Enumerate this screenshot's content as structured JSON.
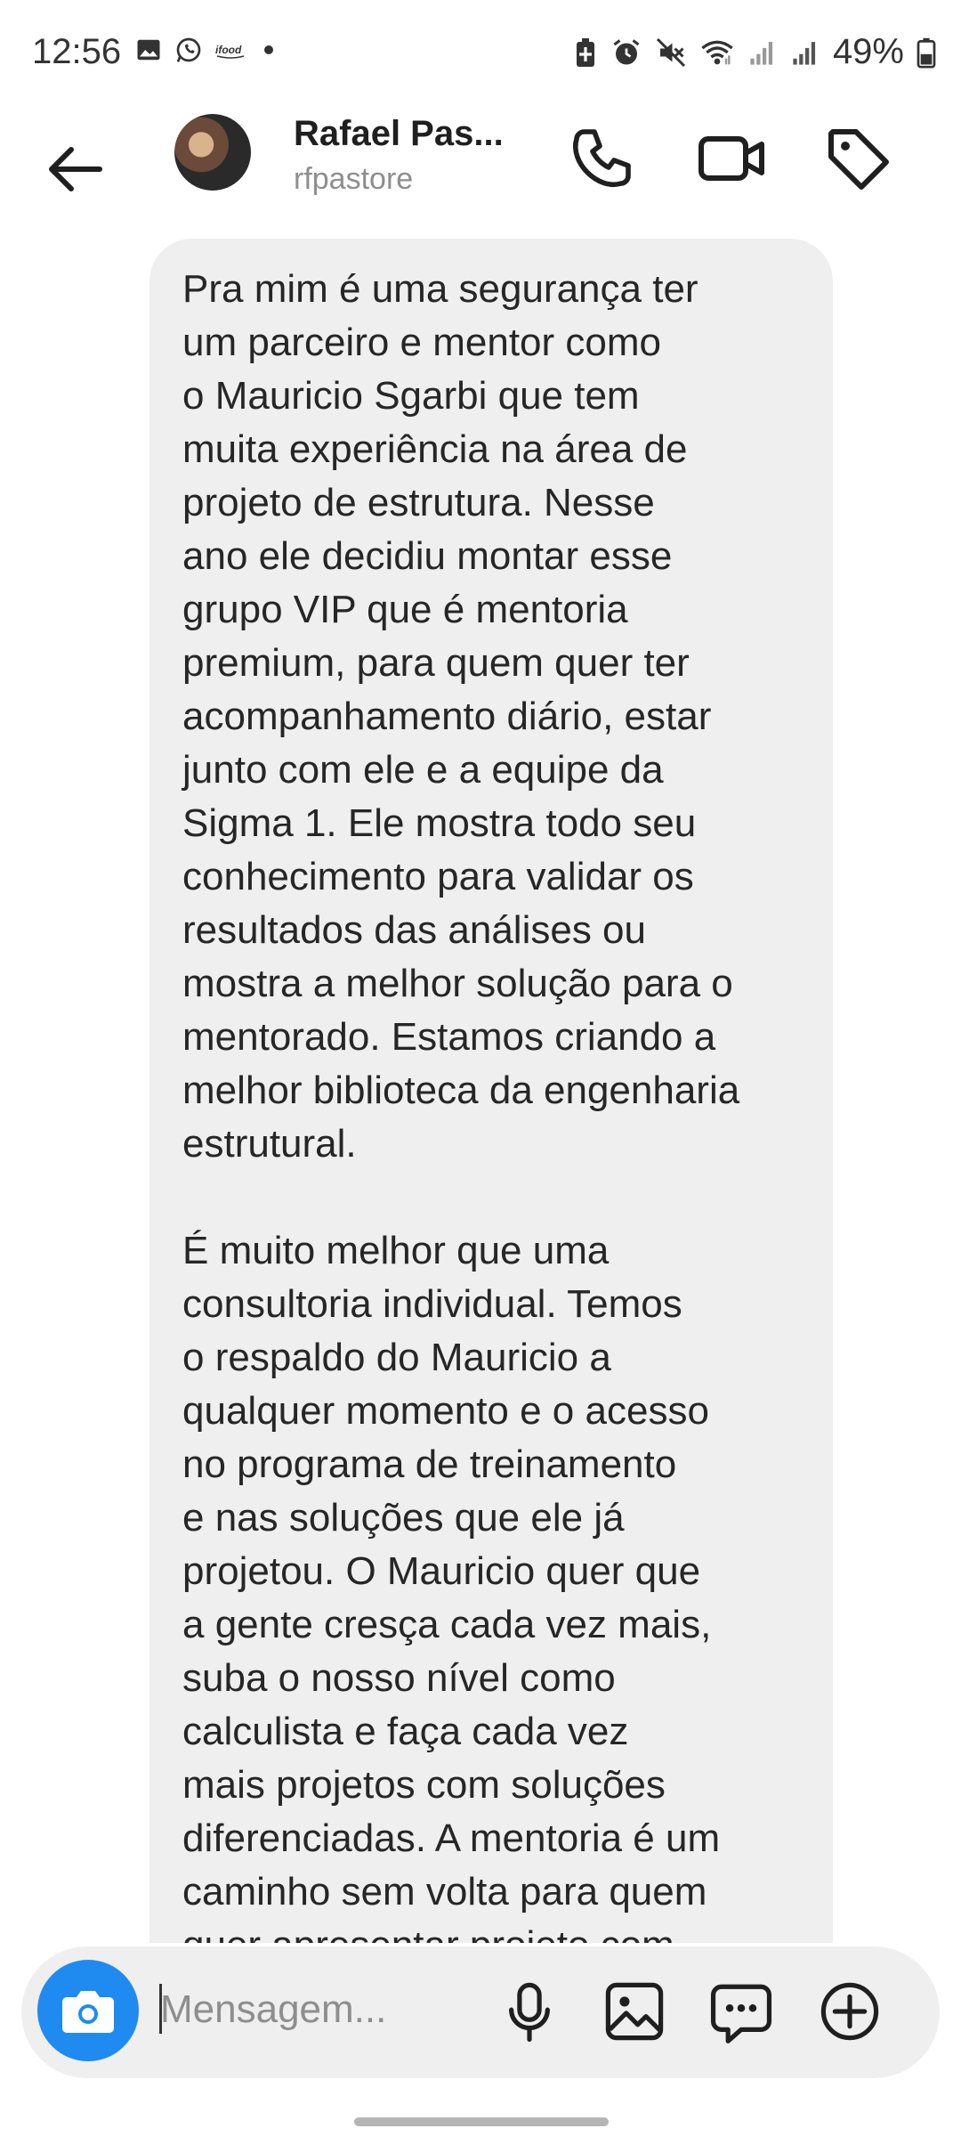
{
  "status_bar": {
    "time": "12:56",
    "left_icons": [
      "gallery-icon",
      "whatsapp-icon",
      "ifood-icon",
      "dot-icon"
    ],
    "right_icons": [
      "battery-saver-icon",
      "alarm-icon",
      "mute-icon",
      "wifi-icon",
      "signal-icon",
      "signal-icon"
    ],
    "battery": "49%"
  },
  "header": {
    "name": "Rafael Pas...",
    "username": "rfpastore"
  },
  "message": {
    "text": "Pra mim é uma segurança ter\num parceiro e mentor como\no Mauricio  Sgarbi que tem\nmuita experiência na área de\nprojeto de estrutura. Nesse\nano ele decidiu montar esse\ngrupo VIP que é mentoria\npremium, para quem quer ter\nacompanhamento diário, estar\njunto com ele e a equipe da\nSigma 1. Ele mostra todo seu\nconhecimento para validar os\nresultados das análises ou\nmostra a melhor solução para o\nmentorado. Estamos criando a\nmelhor biblioteca da engenharia\nestrutural.\n\nÉ muito melhor que uma\nconsultoria individual. Temos\no respaldo do Mauricio a\nqualquer momento e o acesso\nno programa de treinamento\ne nas soluções que ele já\nprojetou. O Mauricio quer que\na gente cresça cada vez mais,\nsuba o nosso nível como\ncalculista e faça cada vez\nmais projetos com soluções\ndiferenciadas. A mentoria é um\ncaminho sem volta para quem\nquer apresentar projeto com"
  },
  "composer": {
    "placeholder": "Mensagem..."
  },
  "colors": {
    "accent": "#1f8bf1",
    "bubble": "#efefef",
    "text": "#262626",
    "muted": "#8e8e8e"
  }
}
